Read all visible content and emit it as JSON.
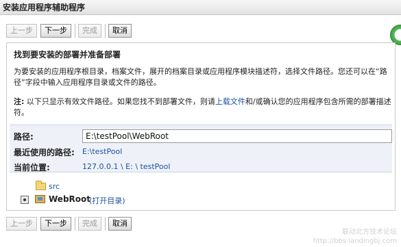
{
  "window": {
    "title": "安装应用程序辅助程序"
  },
  "toolbar": {
    "prev_label": "上一步",
    "next_label": "下一步",
    "finish_label": "完成",
    "cancel_label": "取消"
  },
  "panel": {
    "heading": "找到要安装的部署并准备部署",
    "para1": "为要安装的应用程序根目录，档案文件，展开的档案目录或应用程序模块描述符，选择文件路径。您还可以在“路径”字段中输入应用程序目录或文件的路径。",
    "note_prefix": "注:",
    "note_text": " 以下只显示有效文件路径。如果您找不到部署文件，则请",
    "note_link": "上载文件",
    "note_suffix": "和/或确认您的应用程序包含所需的部署描述符。"
  },
  "info": {
    "path_label": "路径:",
    "path_value": "E:\\testPool\\WebRoot",
    "recent_label": "最近使用的路径:",
    "recent_value": "E:\\testPool",
    "location_label": "当前位置:",
    "location_value": "127.0.0.1 \\ E: \\ testPool"
  },
  "tree": {
    "folder_label": "src",
    "app_label": "WebRoot",
    "open_dir_label": "(打开目录)"
  },
  "watermark": {
    "line1": "联动北方技术论坛",
    "line2": "http://bbs.landingbj.com"
  },
  "icons": {
    "folder": "folder-icon",
    "app": "web-application-icon",
    "radio": "radio-selected-icon"
  },
  "colors": {
    "link": "#1a4fa0",
    "info_bg": "#eef2f8"
  }
}
